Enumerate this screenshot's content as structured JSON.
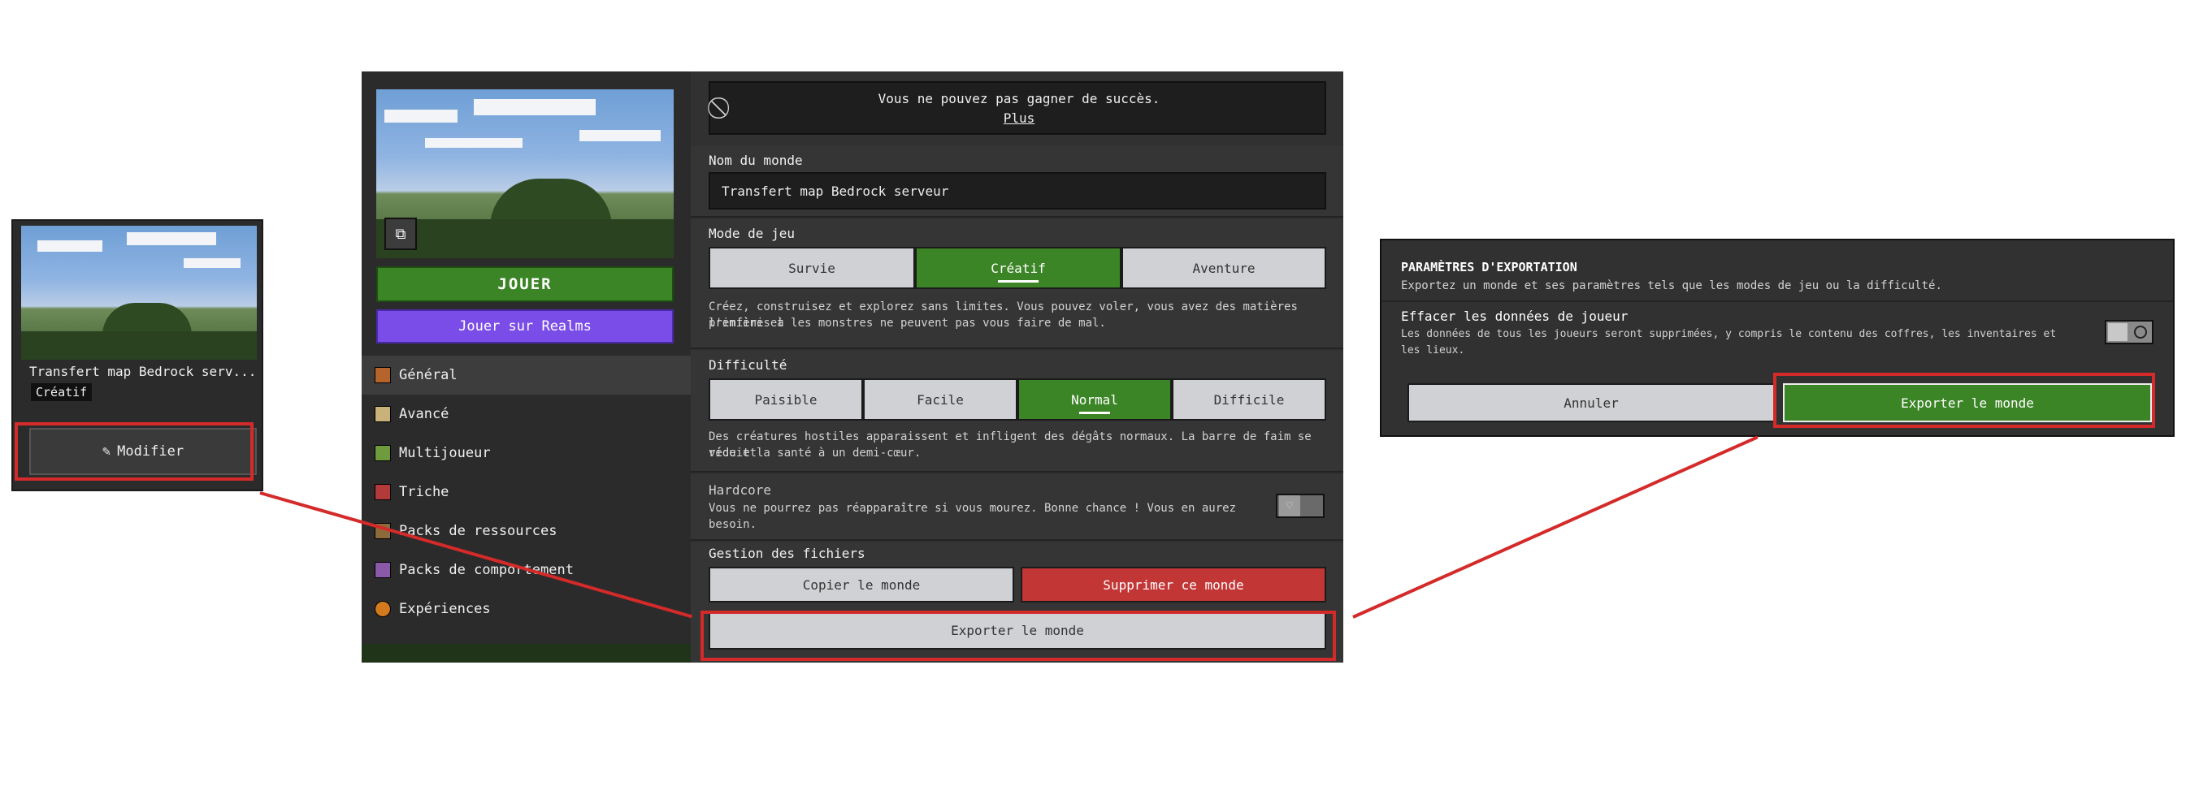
{
  "card": {
    "title": "Transfert map Bedrock serv...",
    "mode_badge": "Créatif",
    "edit_button": "Modifier"
  },
  "sidebar": {
    "play_button": "JOUER",
    "realms_button": "Jouer sur Realms",
    "items": [
      {
        "label": "Général",
        "icon": "general-icon",
        "color": "#b5652b"
      },
      {
        "label": "Avancé",
        "icon": "advanced-icon",
        "color": "#c9b27a"
      },
      {
        "label": "Multijoueur",
        "icon": "multiplayer-icon",
        "color": "#6f9b3e"
      },
      {
        "label": "Triche",
        "icon": "cheats-icon",
        "color": "#b23a3a"
      },
      {
        "label": "Packs de ressources",
        "icon": "resource-packs-icon",
        "color": "#8c6a3c"
      },
      {
        "label": "Packs de comportement",
        "icon": "behavior-packs-icon",
        "color": "#8a5aa8"
      },
      {
        "label": "Expériences",
        "icon": "experiments-icon",
        "color": "#d37a1e"
      }
    ]
  },
  "main": {
    "banner_text": "Vous ne pouvez pas gagner de succès.",
    "banner_link": "Plus",
    "world_name_label": "Nom du monde",
    "world_name_value": "Transfert map Bedrock serveur",
    "game_mode_label": "Mode de jeu",
    "game_modes": [
      "Survie",
      "Créatif",
      "Aventure"
    ],
    "game_mode_selected": "Créatif",
    "game_mode_desc_1": "Créez, construisez et explorez sans limites. Vous pouvez voler, vous avez des matières premières à",
    "game_mode_desc_2": "l'infini et les monstres ne peuvent pas vous faire de mal.",
    "difficulty_label": "Difficulté",
    "difficulties": [
      "Paisible",
      "Facile",
      "Normal",
      "Difficile"
    ],
    "difficulty_selected": "Normal",
    "difficulty_desc_1": "Des créatures hostiles apparaissent et infligent des dégâts normaux. La barre de faim se vide et",
    "difficulty_desc_2": "réduit la santé à un demi-cœur.",
    "hardcore_label": "Hardcore",
    "hardcore_desc_1": "Vous ne pourrez pas réapparaître si vous mourez. Bonne chance ! Vous en aurez",
    "hardcore_desc_2": "besoin.",
    "files_label": "Gestion des fichiers",
    "copy_button": "Copier le monde",
    "delete_button": "Supprimer ce monde",
    "export_button": "Exporter le monde"
  },
  "export_dialog": {
    "title": "PARAMÈTRES D'EXPORTATION",
    "subtitle": "Exportez un monde et ses paramètres tels que les modes de jeu ou la difficulté.",
    "clear_label": "Effacer les données de joueur",
    "clear_desc_1": "Les données de tous les joueurs seront supprimées, y compris le contenu des coffres, les inventaires et",
    "clear_desc_2": "les lieux.",
    "cancel_button": "Annuler",
    "export_button": "Exporter le monde"
  },
  "colors": {
    "highlight": "#d42a2a",
    "green": "#3c8527",
    "purple": "#7b4de8",
    "red": "#c33636"
  }
}
